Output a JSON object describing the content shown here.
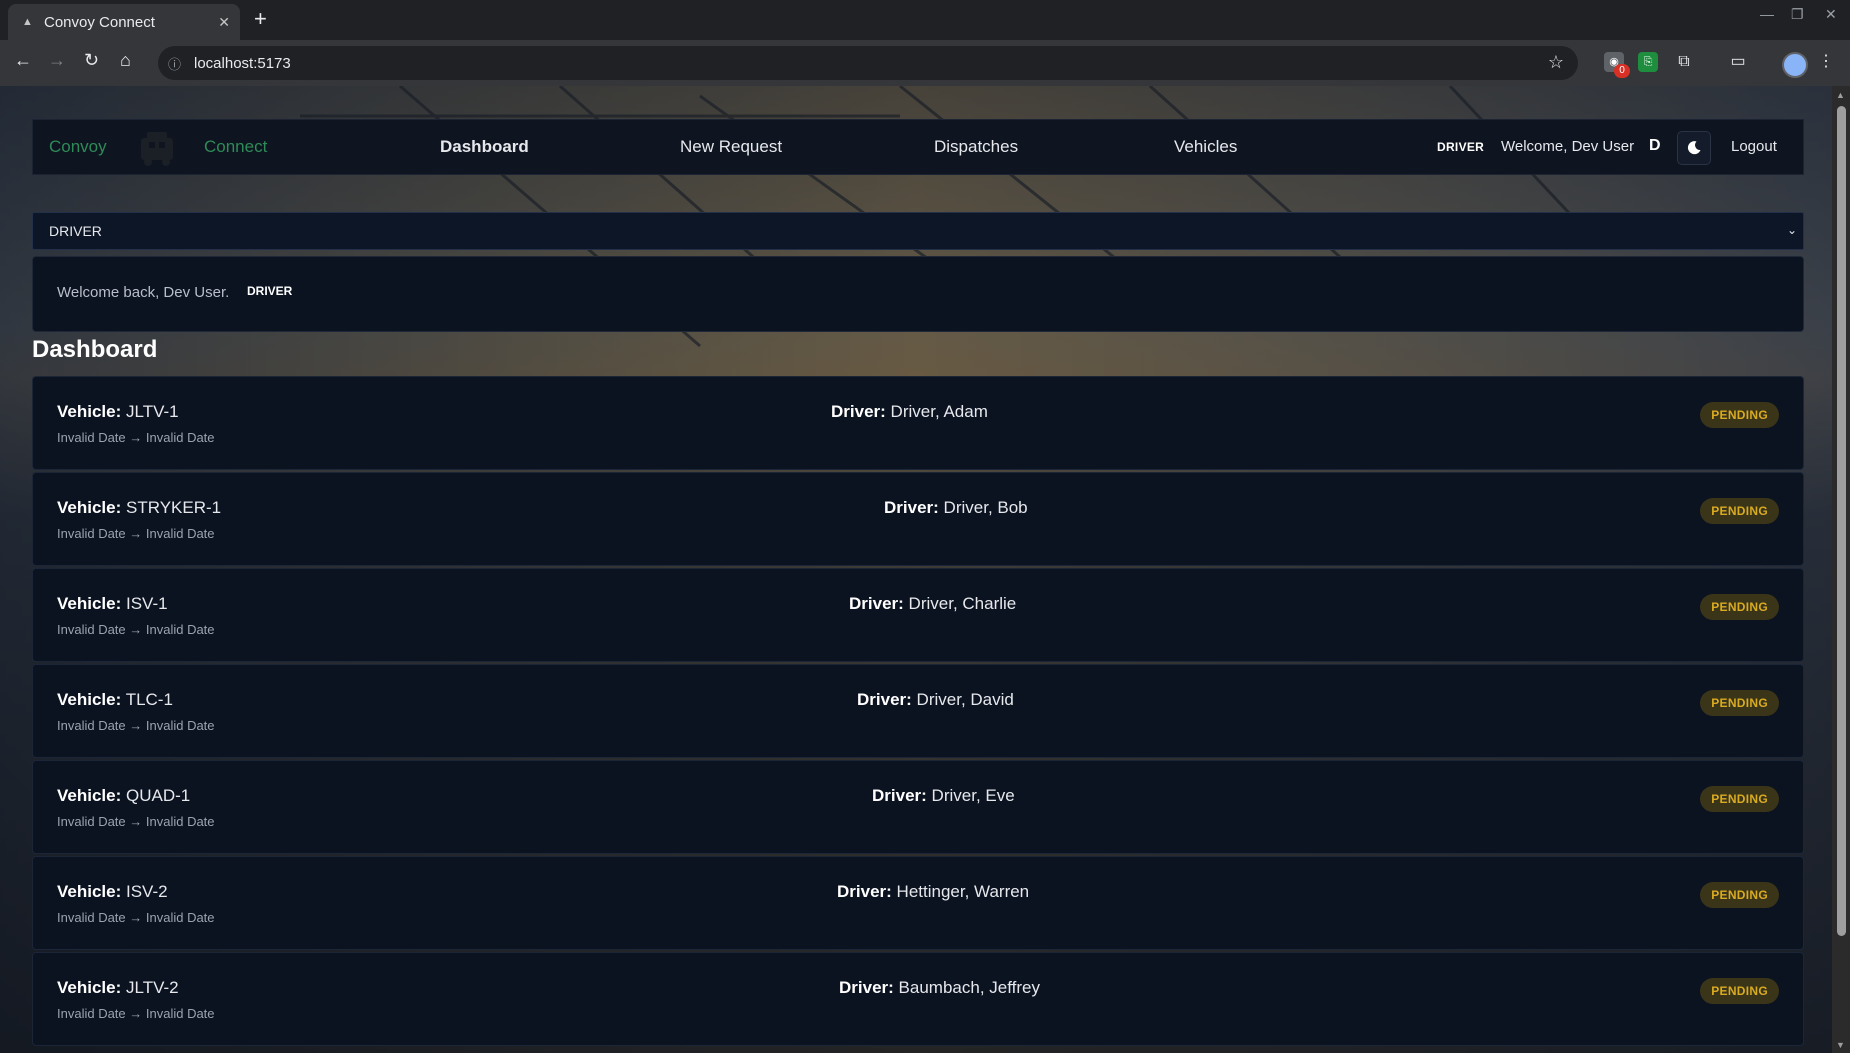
{
  "browser": {
    "tab_title": "Convoy Connect",
    "url": "localhost:5173",
    "extension_badge": "0"
  },
  "nav": {
    "brand_left": "Convoy",
    "brand_right": "Connect",
    "links": [
      "Dashboard",
      "New Request",
      "Dispatches",
      "Vehicles"
    ],
    "role": "DRIVER",
    "welcome": "Welcome, Dev User",
    "initial": "D",
    "logout": "Logout"
  },
  "role_select": {
    "value": "DRIVER"
  },
  "welcome_card": {
    "text": "Welcome back, Dev User.",
    "role": "DRIVER"
  },
  "page_title": "Dashboard",
  "dispatches": [
    {
      "vehicle_label": "Vehicle:",
      "vehicle": "JLTV-1",
      "dates": "Invalid Date → Invalid Date",
      "driver_label": "Driver:",
      "driver": "Driver, Adam",
      "status": "PENDING"
    },
    {
      "vehicle_label": "Vehicle:",
      "vehicle": "STRYKER-1",
      "dates": "Invalid Date → Invalid Date",
      "driver_label": "Driver:",
      "driver": "Driver, Bob",
      "status": "PENDING"
    },
    {
      "vehicle_label": "Vehicle:",
      "vehicle": "ISV-1",
      "dates": "Invalid Date → Invalid Date",
      "driver_label": "Driver:",
      "driver": "Driver, Charlie",
      "status": "PENDING"
    },
    {
      "vehicle_label": "Vehicle:",
      "vehicle": "TLC-1",
      "dates": "Invalid Date → Invalid Date",
      "driver_label": "Driver:",
      "driver": "Driver, David",
      "status": "PENDING"
    },
    {
      "vehicle_label": "Vehicle:",
      "vehicle": "QUAD-1",
      "dates": "Invalid Date → Invalid Date",
      "driver_label": "Driver:",
      "driver": "Driver, Eve",
      "status": "PENDING"
    },
    {
      "vehicle_label": "Vehicle:",
      "vehicle": "ISV-2",
      "dates": "Invalid Date → Invalid Date",
      "driver_label": "Driver:",
      "driver": "Hettinger, Warren",
      "status": "PENDING"
    },
    {
      "vehicle_label": "Vehicle:",
      "vehicle": "JLTV-2",
      "dates": "Invalid Date → Invalid Date",
      "driver_label": "Driver:",
      "driver": "Baumbach, Jeffrey",
      "status": "PENDING"
    }
  ],
  "colors": {
    "brand_green": "#2e8b57",
    "card_bg": "#0b1220",
    "pending_text": "#d9ab21",
    "pending_bg": "#3a3418"
  }
}
